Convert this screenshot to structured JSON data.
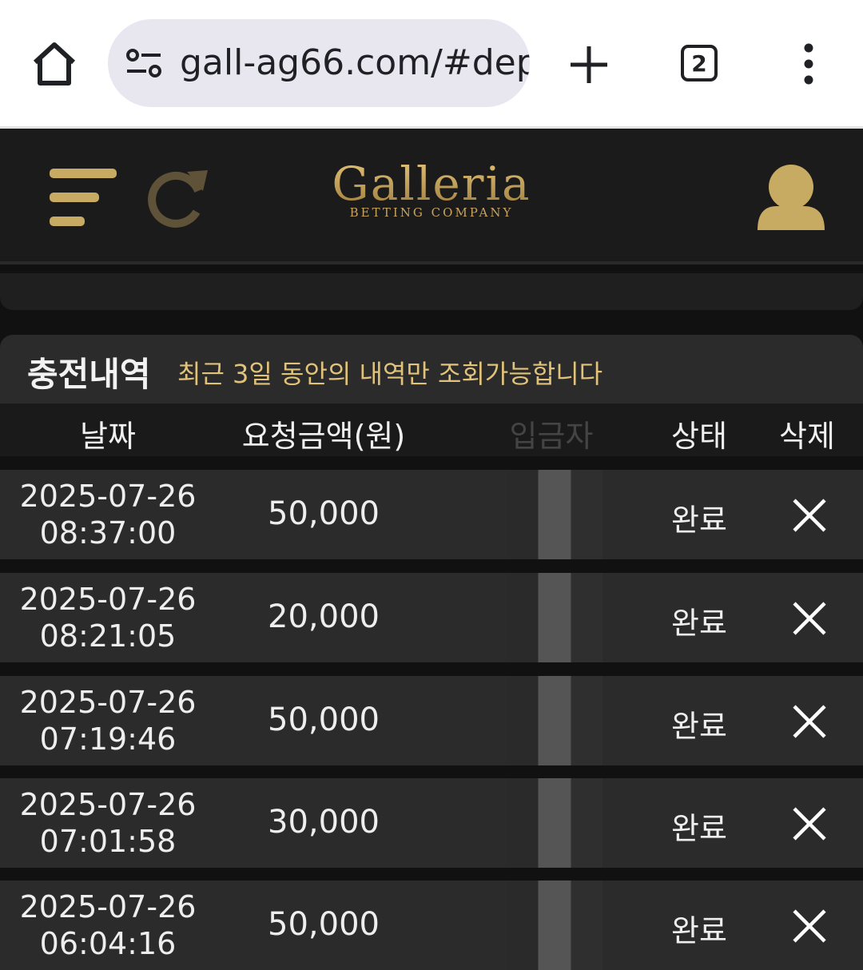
{
  "browser": {
    "url": "gall-ag66.com/#dep",
    "tab_count": "2"
  },
  "app": {
    "logo_title": "Galleria",
    "logo_subtitle": "BETTING COMPANY"
  },
  "section": {
    "title": "충전내역",
    "note": "최근 3일 동안의 내역만 조회가능합니다"
  },
  "table": {
    "headers": {
      "date": "날짜",
      "amount": "요청금액(원)",
      "depositor": "입금자",
      "status": "상태",
      "delete": "삭제"
    },
    "rows": [
      {
        "date": "2025-07-26",
        "time": "08:37:00",
        "amount": "50,000",
        "status": "완료"
      },
      {
        "date": "2025-07-26",
        "time": "08:21:05",
        "amount": "20,000",
        "status": "완료"
      },
      {
        "date": "2025-07-26",
        "time": "07:19:46",
        "amount": "50,000",
        "status": "완료"
      },
      {
        "date": "2025-07-26",
        "time": "07:01:58",
        "amount": "30,000",
        "status": "완료"
      },
      {
        "date": "2025-07-26",
        "time": "06:04:16",
        "amount": "50,000",
        "status": "완료"
      }
    ]
  },
  "colors": {
    "accent_gold": "#c2a25c",
    "background": "#111111",
    "row_bg": "#2b2b2b"
  }
}
